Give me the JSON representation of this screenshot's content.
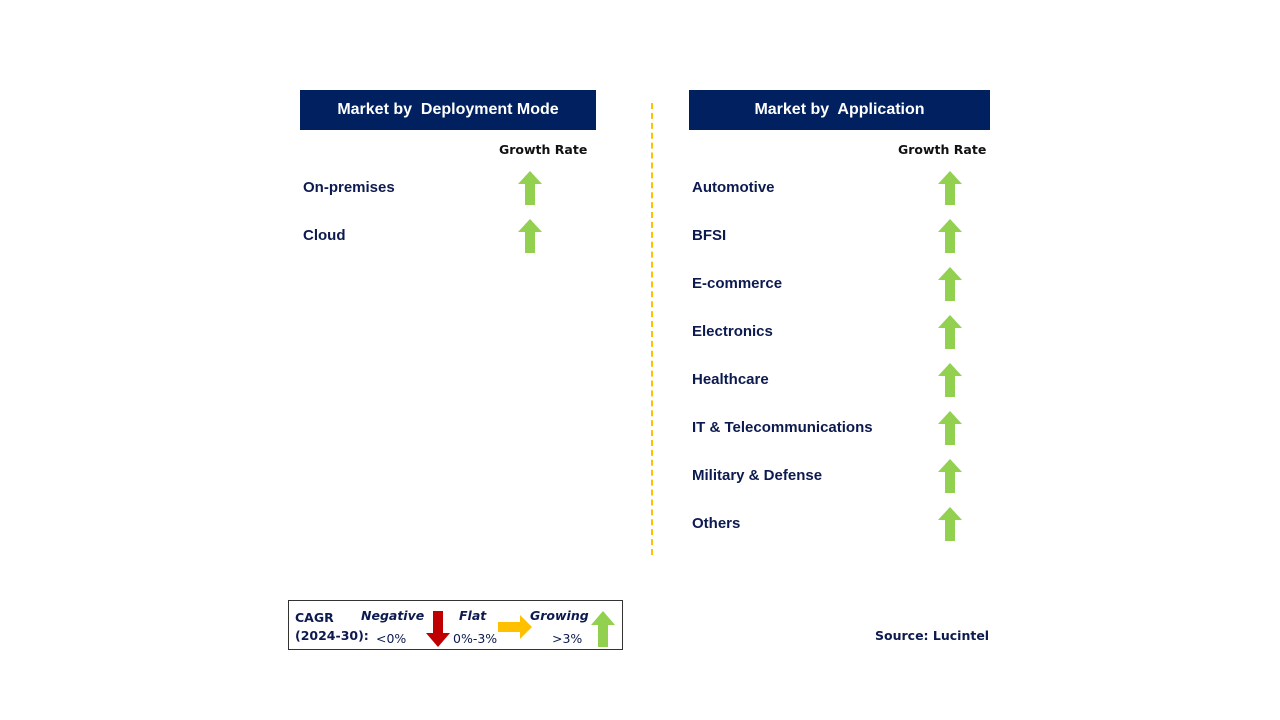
{
  "left_panel": {
    "title": "Market by  Deployment Mode",
    "column_header": "Growth Rate",
    "rows": [
      {
        "label": "On-premises",
        "trend": "growing"
      },
      {
        "label": "Cloud",
        "trend": "growing"
      }
    ]
  },
  "right_panel": {
    "title": "Market by  Application",
    "column_header": "Growth Rate",
    "rows": [
      {
        "label": "Automotive",
        "trend": "growing"
      },
      {
        "label": "BFSI",
        "trend": "growing"
      },
      {
        "label": "E-commerce",
        "trend": "growing"
      },
      {
        "label": "Electronics",
        "trend": "growing"
      },
      {
        "label": "Healthcare",
        "trend": "growing"
      },
      {
        "label": "IT & Telecommunications",
        "trend": "growing"
      },
      {
        "label": "Military & Defense",
        "trend": "growing"
      },
      {
        "label": "Others",
        "trend": "growing"
      }
    ]
  },
  "legend": {
    "cagr_label": "CAGR",
    "period": "(2024-30):",
    "negative": {
      "label": "Negative",
      "range": "<0%",
      "icon": "arrow-down-icon",
      "color": "#c00000"
    },
    "flat": {
      "label": "Flat",
      "range": "0%-3%",
      "icon": "arrow-right-icon",
      "color": "#ffc000"
    },
    "growing": {
      "label": "Growing",
      "range": ">3%",
      "icon": "arrow-up-icon",
      "color": "#92d050"
    }
  },
  "source": "Source: Lucintel",
  "colors": {
    "header_bg": "#002060",
    "text": "#0d1a4f",
    "divider": "#ffc000",
    "growing": "#92d050"
  }
}
